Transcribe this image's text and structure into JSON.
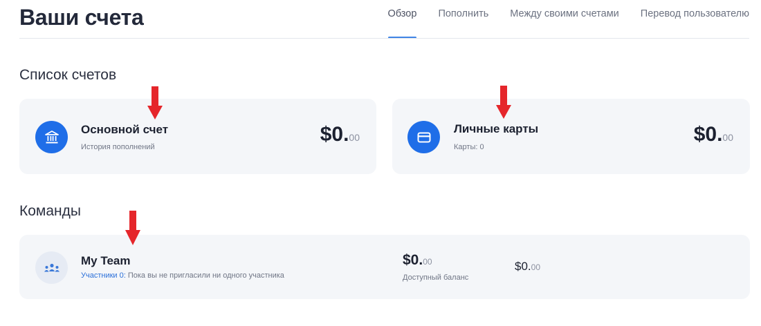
{
  "header": {
    "title": "Ваши счета",
    "tabs": [
      {
        "label": "Обзор",
        "active": true
      },
      {
        "label": "Пополнить",
        "active": false
      },
      {
        "label": "Между своими счетами",
        "active": false
      },
      {
        "label": "Перевод пользователю",
        "active": false
      }
    ]
  },
  "accounts_section": {
    "title": "Список счетов",
    "cards": [
      {
        "title": "Основной счет",
        "subtitle": "История пополнений",
        "amount_main": "$0.",
        "amount_cents": "00",
        "icon": "bank-icon"
      },
      {
        "title": "Личные карты",
        "subtitle": "Карты: 0",
        "amount_main": "$0.",
        "amount_cents": "00",
        "icon": "credit-card-icon"
      }
    ]
  },
  "teams_section": {
    "title": "Команды",
    "team": {
      "name": "My Team",
      "members_label": "Участники 0:",
      "members_text": "Пока вы не пригласили ни одного участника",
      "available_main": "$0.",
      "available_cents": "00",
      "available_label": "Доступный баланс",
      "second_main": "$0.",
      "second_cents": "00",
      "icon": "team-icon"
    }
  },
  "colors": {
    "accent": "#1f6ee8",
    "arrow": "#e5262b",
    "card_bg": "#f4f6f9"
  }
}
